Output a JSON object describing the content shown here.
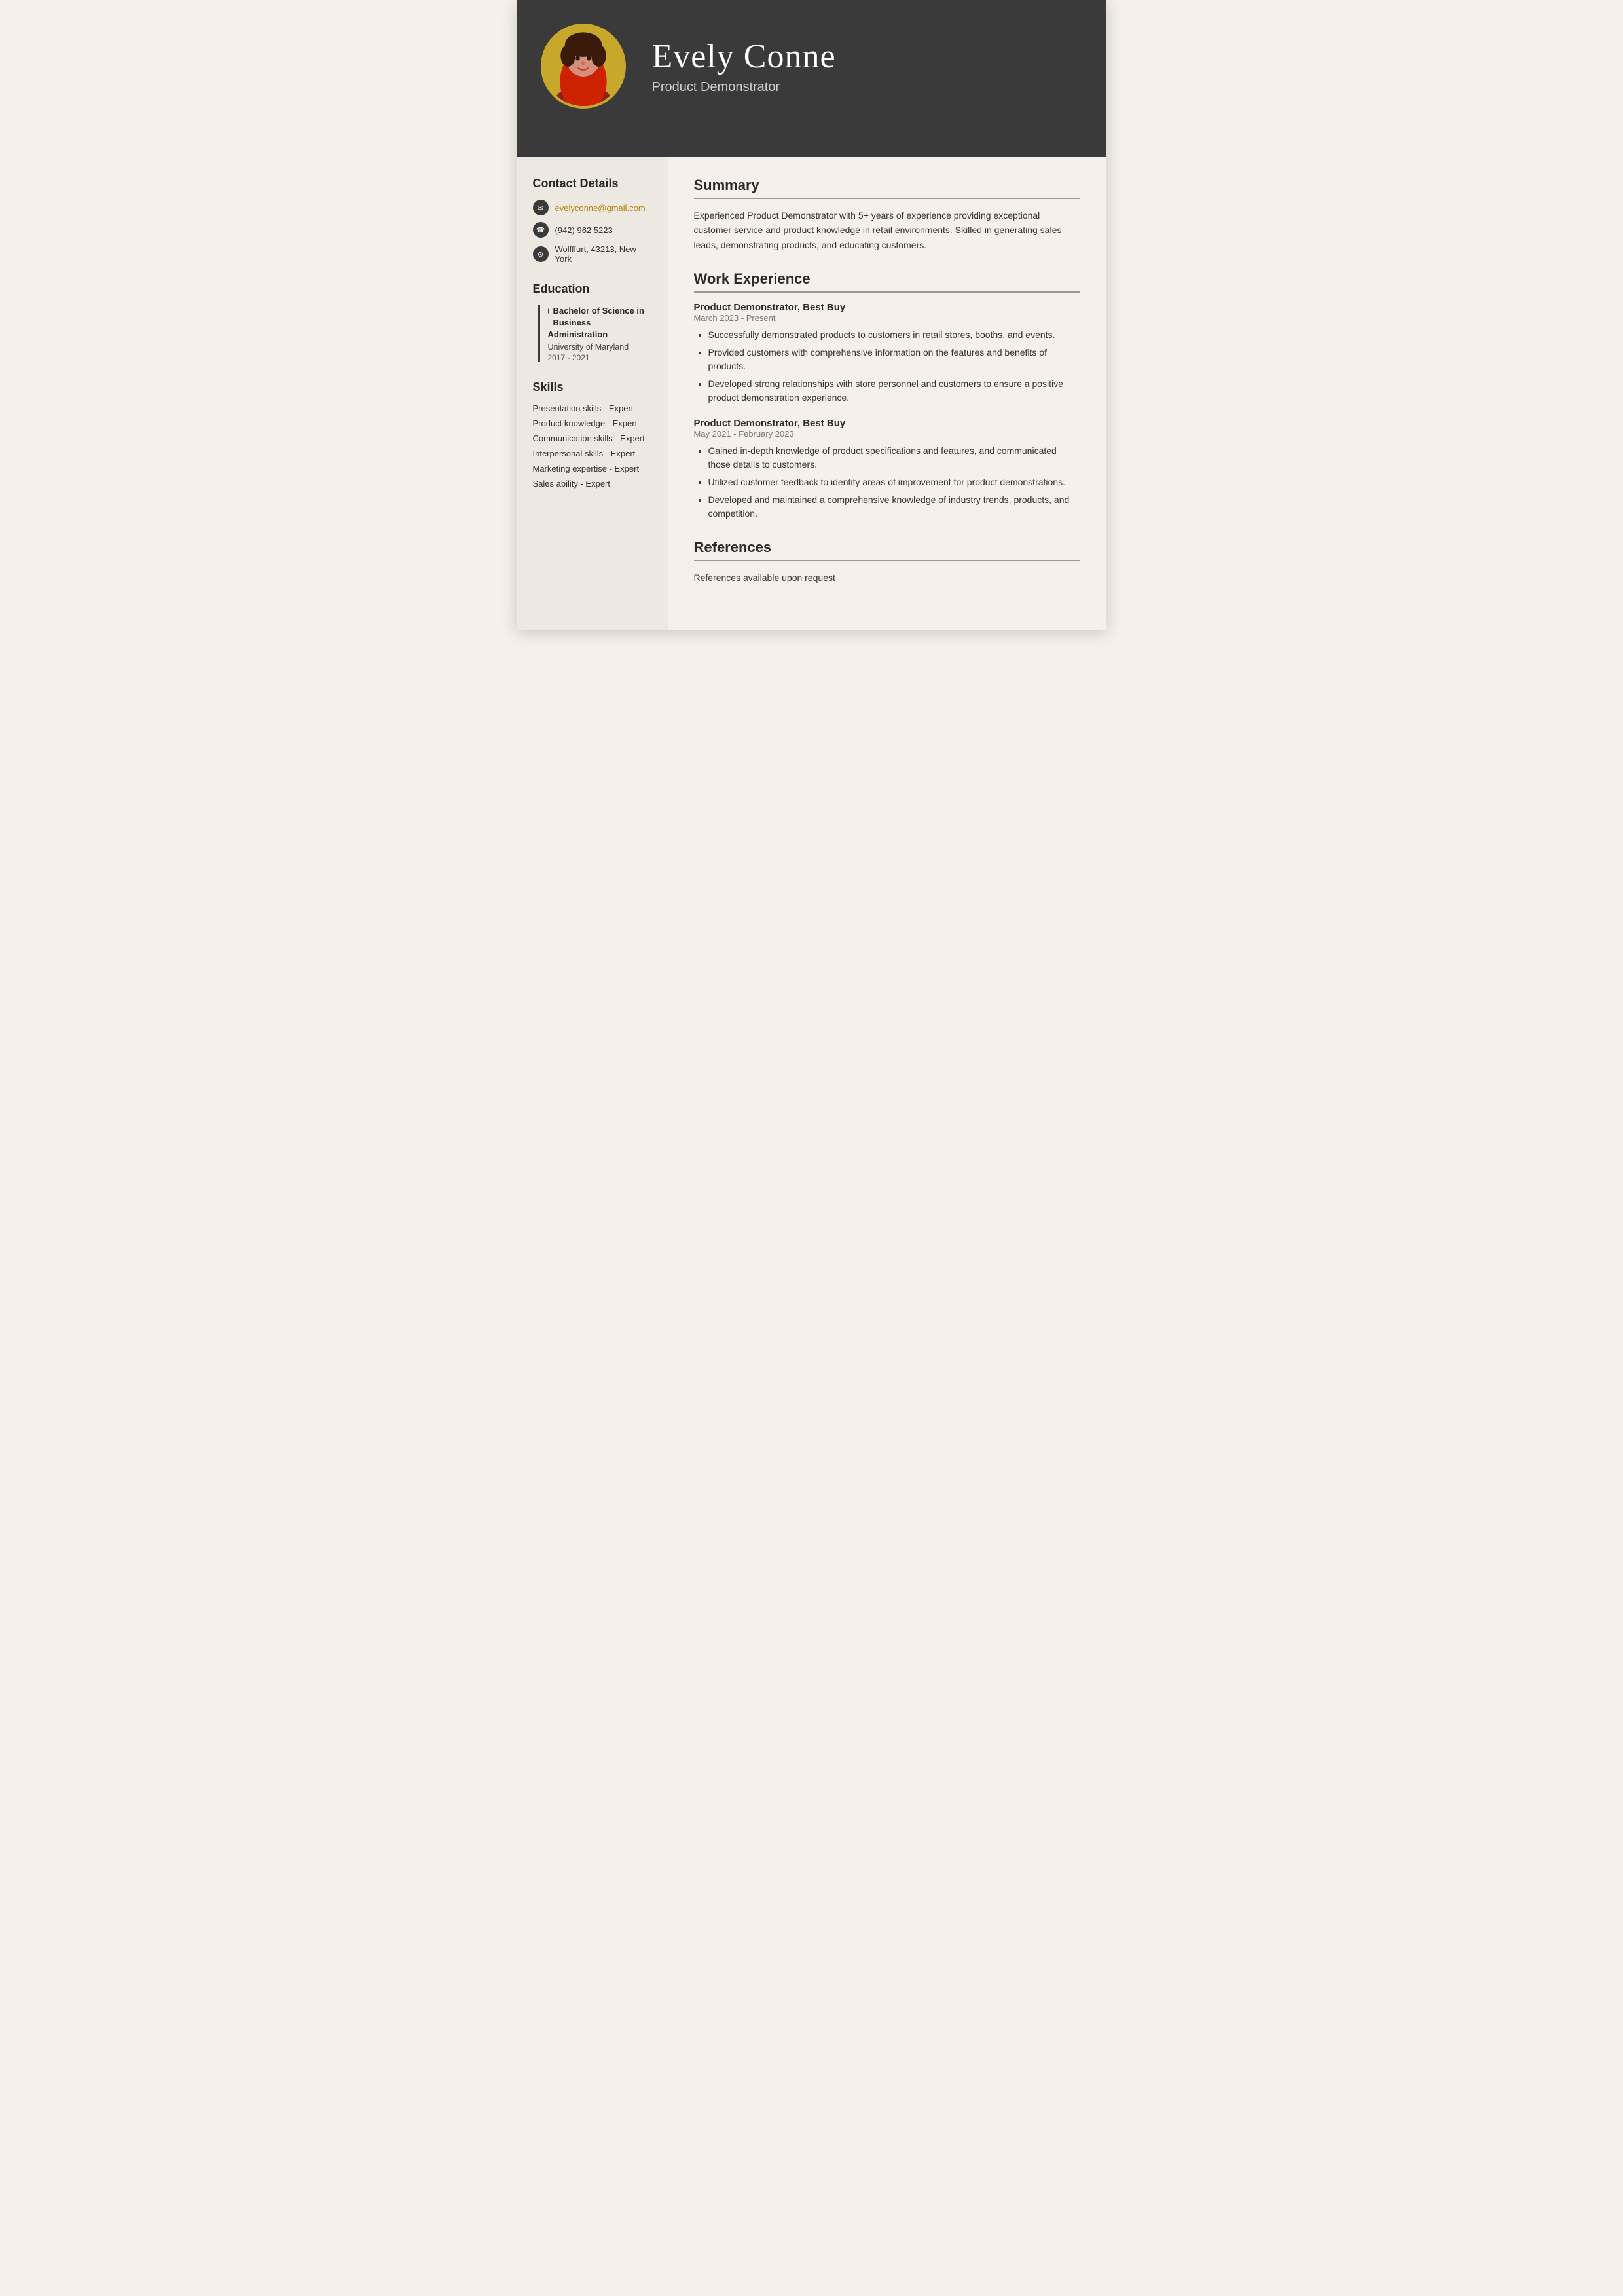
{
  "header": {
    "name": "Evely Conne",
    "title": "Product Demonstrator"
  },
  "contact": {
    "section_title": "Contact Details",
    "email": "evelyconne@gmail.com",
    "phone": "(942) 962 5223",
    "address": "Wolfffurt, 43213, New York"
  },
  "education": {
    "section_title": "Education",
    "items": [
      {
        "degree": "Bachelor of Science in Business Administration",
        "school": "University of Maryland",
        "years": "2017 - 2021"
      }
    ]
  },
  "skills": {
    "section_title": "Skills",
    "items": [
      "Presentation skills - Expert",
      "Product knowledge - Expert",
      "Communication skills - Expert",
      "Interpersonal skills - Expert",
      "Marketing expertise - Expert",
      "Sales ability - Expert"
    ]
  },
  "summary": {
    "section_title": "Summary",
    "text": "Experienced Product Demonstrator with 5+ years of experience providing exceptional customer service and product knowledge in retail environments. Skilled in generating sales leads, demonstrating products, and educating customers."
  },
  "work_experience": {
    "section_title": "Work Experience",
    "jobs": [
      {
        "title": "Product Demonstrator, Best Buy",
        "period": "March 2023 - Present",
        "bullets": [
          "Successfully demonstrated products to customers in retail stores, booths, and events.",
          "Provided customers with comprehensive information on the features and benefits of products.",
          "Developed strong relationships with store personnel and customers to ensure a positive product demonstration experience."
        ]
      },
      {
        "title": "Product Demonstrator, Best Buy",
        "period": "May 2021 - February 2023",
        "bullets": [
          "Gained in-depth knowledge of product specifications and features, and communicated those details to customers.",
          "Utilized customer feedback to identify areas of improvement for product demonstrations.",
          "Developed and maintained a comprehensive knowledge of industry trends, products, and competition."
        ]
      }
    ]
  },
  "references": {
    "section_title": "References",
    "text": "References available upon request"
  }
}
